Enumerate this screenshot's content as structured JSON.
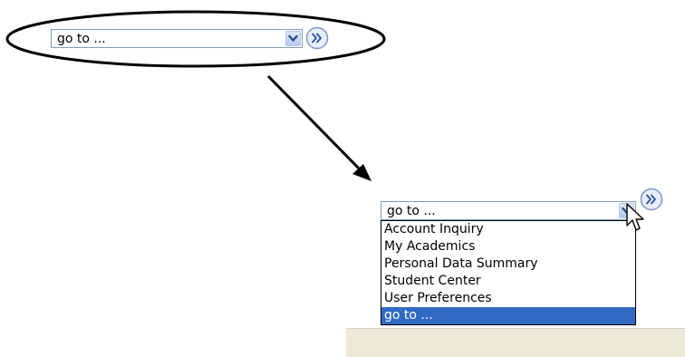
{
  "collapsed": {
    "selected": "go to ..."
  },
  "expanded": {
    "selected": "go to ...",
    "options": [
      "Account Inquiry",
      "My Academics",
      "Personal Data Summary",
      "Student Center",
      "User Preferences",
      "go to ..."
    ],
    "highlighted_index": 5
  },
  "colors": {
    "field_border": "#7f9db9",
    "highlight": "#316ac5",
    "button_blue": "#c5d6f7"
  },
  "icons": {
    "dropdown": "chevron-down-icon",
    "go": "double-chevron-right-icon",
    "cursor": "mouse-pointer-icon"
  }
}
